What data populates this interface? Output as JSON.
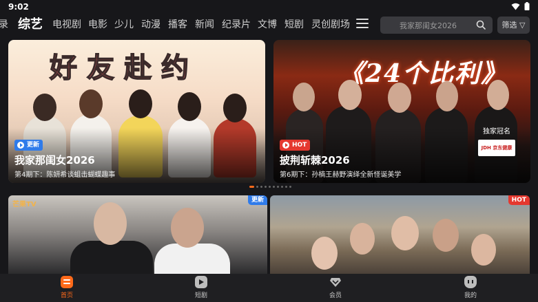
{
  "status_bar": {
    "time": "9:02"
  },
  "nav": {
    "tabs": [
      {
        "label": "录",
        "active": false
      },
      {
        "label": "综艺",
        "active": true
      },
      {
        "label": "电视剧",
        "active": false
      },
      {
        "label": "电影",
        "active": false
      },
      {
        "label": "少儿",
        "active": false
      },
      {
        "label": "动漫",
        "active": false
      },
      {
        "label": "播客",
        "active": false
      },
      {
        "label": "新闻",
        "active": false
      },
      {
        "label": "纪录片",
        "active": false
      },
      {
        "label": "文博",
        "active": false
      },
      {
        "label": "短剧",
        "active": false
      },
      {
        "label": "灵创剧场",
        "active": false
      }
    ],
    "menu_icon": "hamburger-icon"
  },
  "search": {
    "placeholder": "我家那闺女2026",
    "icon": "search-icon"
  },
  "filter": {
    "label": "筛选 ▽"
  },
  "banners": [
    {
      "artwork_text": "好友赴约",
      "badge": "更新",
      "title": "我家那闺女2026",
      "subtitle": "第4期下：陈妍希谈蛆击蝴蝶趣事"
    },
    {
      "artwork_text": "《24个比利》",
      "badge": "HOT",
      "title": "披荆斩棘2026",
      "subtitle": "第6期下：孙楠王赫野演绎全新怪诞美学",
      "sponsor_label": "独家冠名",
      "sponsor_logo": "JDH 京东健康"
    }
  ],
  "carousel": {
    "count": 10,
    "active": 0
  },
  "rows": [
    {
      "badge": "更新",
      "watermark": "芒果TV"
    },
    {
      "badge": "HOT"
    }
  ],
  "bottom_nav": [
    {
      "label": "首页",
      "active": true
    },
    {
      "label": "短剧",
      "active": false
    },
    {
      "label": "会员",
      "active": false
    },
    {
      "label": "我的",
      "active": false
    }
  ],
  "colors": {
    "accent": "#ff6a1a",
    "badge_blue": "#2f7bea",
    "badge_red": "#e5382f"
  }
}
